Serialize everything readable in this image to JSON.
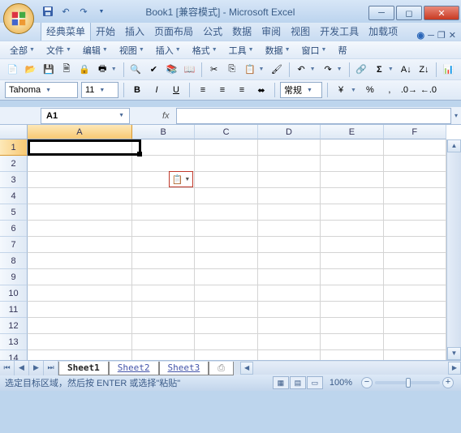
{
  "title": "Book1 [兼容模式] - Microsoft Excel",
  "tabs": [
    "经典菜单",
    "开始",
    "插入",
    "页面布局",
    "公式",
    "数据",
    "审阅",
    "视图",
    "开发工具",
    "加载项"
  ],
  "active_tab": 0,
  "menus": [
    "全部",
    "文件",
    "编辑",
    "视图",
    "插入",
    "格式",
    "工具",
    "数据",
    "窗口",
    "帮"
  ],
  "font_name": "Tahoma",
  "font_size": "11",
  "number_format": "常规",
  "cell_ref": "A1",
  "formula_value": "",
  "columns": [
    "A",
    "B",
    "C",
    "D",
    "E",
    "F"
  ],
  "rows": [
    "1",
    "2",
    "3",
    "4",
    "5",
    "6",
    "7",
    "8",
    "9",
    "10",
    "11",
    "12",
    "13",
    "14"
  ],
  "a1_value": "",
  "sheets": [
    "Sheet1",
    "Sheet2",
    "Sheet3"
  ],
  "active_sheet": 0,
  "status_text": "选定目标区域，然后按 ENTER 或选择\"粘贴\"",
  "zoom": "100%"
}
